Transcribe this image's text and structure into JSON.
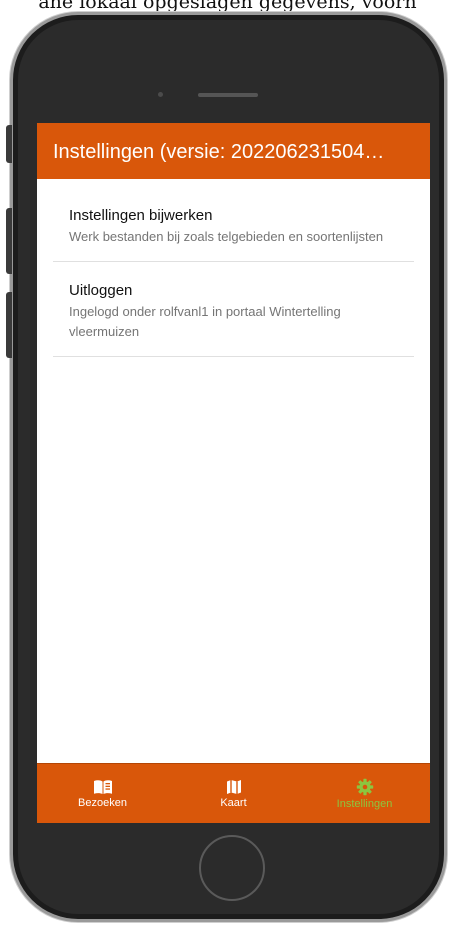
{
  "page_caption": "ane lokaal opgeslagen gegevens, voorn",
  "app": {
    "title": "Instellingen (versie: 202206231504…"
  },
  "settings": [
    {
      "title": "Instellingen bijwerken",
      "subtitle": "Werk bestanden bij zoals telgebieden en soortenlijsten"
    },
    {
      "title": "Uitloggen",
      "subtitle": "Ingelogd onder rolfvanl1 in portaal Wintertelling vleermuizen"
    }
  ],
  "bottom_nav": [
    {
      "label": "Bezoeken",
      "icon": "book-icon",
      "active": false
    },
    {
      "label": "Kaart",
      "icon": "map-icon",
      "active": false
    },
    {
      "label": "Instellingen",
      "icon": "gear-icon",
      "active": true
    }
  ],
  "colors": {
    "accent": "#d9570a",
    "active_tab": "#8cc63f",
    "phone_body": "#2b2b2b"
  }
}
